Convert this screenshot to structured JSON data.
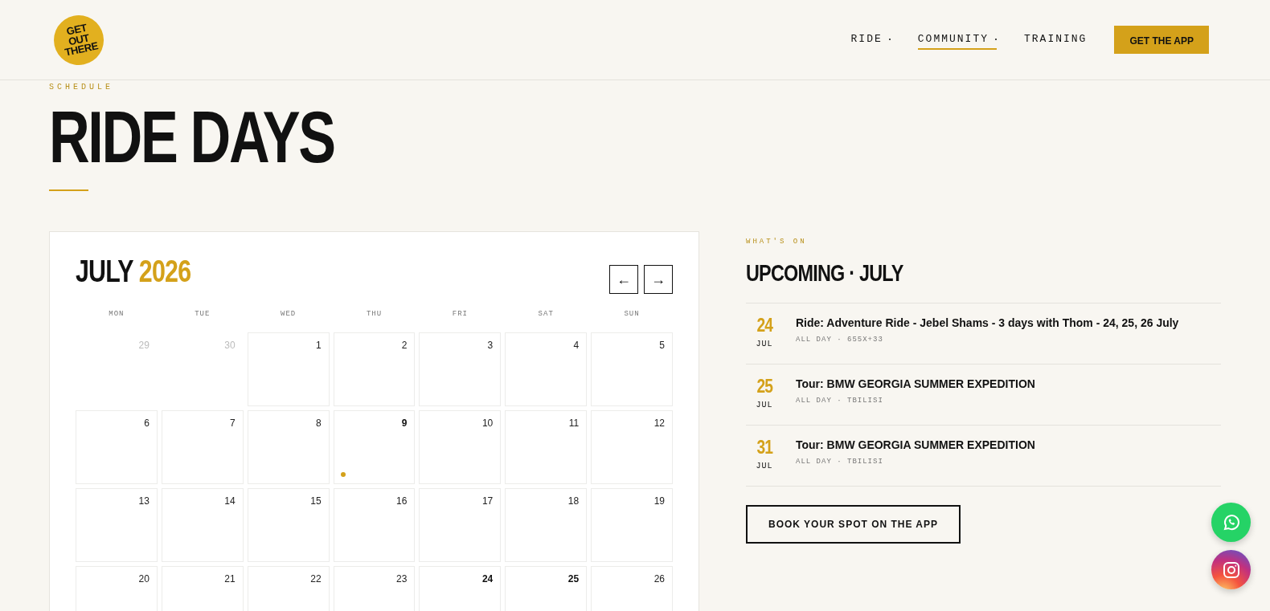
{
  "header": {
    "logo": "GET OUT THERE",
    "nav": [
      {
        "label": "RIDE",
        "dropdown": true,
        "selected": false
      },
      {
        "label": "COMMUNITY",
        "dropdown": true,
        "selected": true
      },
      {
        "label": "TRAINING",
        "dropdown": false,
        "selected": false
      }
    ],
    "cta": "GET THE APP"
  },
  "hero": {
    "eyebrow": "SCHEDULE",
    "title": "RIDE DAYS"
  },
  "calendar": {
    "month": "JULY",
    "year": "2026",
    "prev": "←",
    "next": "→",
    "weekdays": [
      "MON",
      "TUE",
      "WED",
      "THU",
      "FRI",
      "SAT",
      "SUN"
    ],
    "days": [
      {
        "label": "29",
        "outside": true,
        "today": false,
        "has_event": false
      },
      {
        "label": "30",
        "outside": true,
        "today": false,
        "has_event": false
      },
      {
        "label": "1",
        "outside": false,
        "today": false,
        "has_event": false
      },
      {
        "label": "2",
        "outside": false,
        "today": false,
        "has_event": false
      },
      {
        "label": "3",
        "outside": false,
        "today": false,
        "has_event": false
      },
      {
        "label": "4",
        "outside": false,
        "today": false,
        "has_event": false
      },
      {
        "label": "5",
        "outside": false,
        "today": false,
        "has_event": false
      },
      {
        "label": "6",
        "outside": false,
        "today": false,
        "has_event": false
      },
      {
        "label": "7",
        "outside": false,
        "today": false,
        "has_event": false
      },
      {
        "label": "8",
        "outside": false,
        "today": false,
        "has_event": false
      },
      {
        "label": "9",
        "outside": false,
        "today": true,
        "has_event": false
      },
      {
        "label": "10",
        "outside": false,
        "today": false,
        "has_event": false
      },
      {
        "label": "11",
        "outside": false,
        "today": false,
        "has_event": false
      },
      {
        "label": "12",
        "outside": false,
        "today": false,
        "has_event": false
      },
      {
        "label": "13",
        "outside": false,
        "today": false,
        "has_event": false
      },
      {
        "label": "14",
        "outside": false,
        "today": false,
        "has_event": false
      },
      {
        "label": "15",
        "outside": false,
        "today": false,
        "has_event": false
      },
      {
        "label": "16",
        "outside": false,
        "today": false,
        "has_event": false
      },
      {
        "label": "17",
        "outside": false,
        "today": false,
        "has_event": false
      },
      {
        "label": "18",
        "outside": false,
        "today": false,
        "has_event": false
      },
      {
        "label": "19",
        "outside": false,
        "today": false,
        "has_event": false
      },
      {
        "label": "20",
        "outside": false,
        "today": false,
        "has_event": false
      },
      {
        "label": "21",
        "outside": false,
        "today": false,
        "has_event": false
      },
      {
        "label": "22",
        "outside": false,
        "today": false,
        "has_event": false
      },
      {
        "label": "23",
        "outside": false,
        "today": false,
        "has_event": false
      },
      {
        "label": "24",
        "outside": false,
        "today": false,
        "has_event": true
      },
      {
        "label": "25",
        "outside": false,
        "today": false,
        "has_event": true
      },
      {
        "label": "26",
        "outside": false,
        "today": false,
        "has_event": false
      }
    ]
  },
  "upcoming": {
    "eyebrow": "WHAT'S ON",
    "title": "UPCOMING · JULY",
    "events": [
      {
        "day": "24",
        "month": "JUL",
        "title": "Ride: Adventure Ride - Jebel Shams - 3 days with Thom - 24, 25, 26 July",
        "meta": "ALL DAY · 655X+33"
      },
      {
        "day": "25",
        "month": "JUL",
        "title": "Tour: BMW GEORGIA SUMMER EXPEDITION",
        "meta": "ALL DAY · TBILISI"
      },
      {
        "day": "31",
        "month": "JUL",
        "title": "Tour: BMW GEORGIA SUMMER EXPEDITION",
        "meta": "ALL DAY · TBILISI"
      }
    ],
    "button": "BOOK YOUR SPOT ON THE APP"
  },
  "floating": [
    {
      "kind": "whatsapp"
    },
    {
      "kind": "instagram"
    }
  ]
}
